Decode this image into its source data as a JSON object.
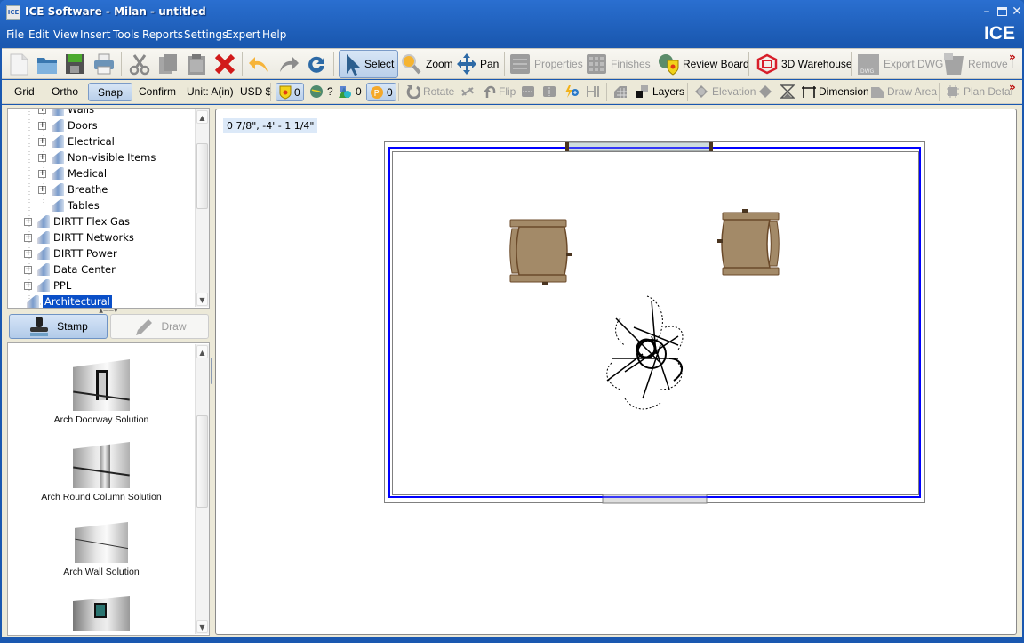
{
  "window": {
    "title": "ICE Software - Milan - untitled",
    "app_icon_text": "ICE",
    "brand": "ICE",
    "controls": [
      "minimize",
      "maximize",
      "close"
    ]
  },
  "menu": [
    "File",
    "Edit",
    "View",
    "Insert",
    "Tools",
    "Reports",
    "Settings",
    "Expert",
    "Help"
  ],
  "toolbar_main": {
    "file_buttons": [
      "new-file",
      "open-folder",
      "save",
      "print"
    ],
    "edit_buttons": [
      "cut",
      "copy",
      "paste",
      "delete"
    ],
    "history_buttons": [
      "undo",
      "redo",
      "refresh"
    ],
    "select": "Select",
    "zoom": "Zoom",
    "pan": "Pan",
    "properties": "Properties",
    "finishes": "Finishes",
    "review_board": "Review Board",
    "warehouse": "3D Warehouse",
    "export_dwg": "Export DWG",
    "remove": "Remove I",
    "more": "»"
  },
  "toolbar_secondary": {
    "grid": "Grid",
    "ortho": "Ortho",
    "snap": "Snap",
    "confirm": "Confirm",
    "unit": "Unit: A(in)",
    "currency": "USD $",
    "badges": [
      {
        "icon": "fire-shield-icon",
        "value": "0"
      },
      {
        "icon": "fyi-globe-icon",
        "value": "?"
      },
      {
        "icon": "shapes-icon",
        "value": "0"
      },
      {
        "icon": "p-coin-icon",
        "value": "0"
      }
    ],
    "rotate": "Rotate",
    "flip": "Flip",
    "layers": "Layers",
    "elevation": "Elevation",
    "dimension": "Dimension",
    "draw_area": "Draw Area",
    "plan_detail": "Plan Detai",
    "more": "»"
  },
  "tree": {
    "items": [
      {
        "label": "Walls",
        "level": 2,
        "expandable": true
      },
      {
        "label": "Doors",
        "level": 2,
        "expandable": true
      },
      {
        "label": "Electrical",
        "level": 2,
        "expandable": true
      },
      {
        "label": "Non-visible Items",
        "level": 2,
        "expandable": true
      },
      {
        "label": "Medical",
        "level": 2,
        "expandable": true
      },
      {
        "label": "Breathe",
        "level": 2,
        "expandable": true
      },
      {
        "label": "Tables",
        "level": 2,
        "expandable": false
      },
      {
        "label": "DIRTT Flex Gas",
        "level": 1,
        "expandable": true
      },
      {
        "label": "DIRTT Networks",
        "level": 1,
        "expandable": true
      },
      {
        "label": "DIRTT Power",
        "level": 1,
        "expandable": true
      },
      {
        "label": "Data Center",
        "level": 1,
        "expandable": true
      },
      {
        "label": "PPL",
        "level": 1,
        "expandable": true
      },
      {
        "label": "Architectural",
        "level": 0,
        "expandable": false,
        "selected": true
      }
    ]
  },
  "modes": {
    "stamp": "Stamp",
    "draw": "Draw",
    "active": "stamp"
  },
  "catalog": {
    "items": [
      {
        "label": "Arch Doorway Solution",
        "thumb": "doorway"
      },
      {
        "label": "Arch Round Column Solution",
        "thumb": "column"
      },
      {
        "label": "Arch Wall Solution",
        "thumb": "wall"
      },
      {
        "label": "",
        "thumb": "window"
      }
    ]
  },
  "canvas": {
    "coordinate_readout": "0 7/8\", -4' - 1 1/4\"",
    "objects": [
      "room-outline",
      "top-window",
      "bottom-door-opening",
      "chair-left",
      "chair-right",
      "plant"
    ]
  },
  "colors": {
    "title_bar": "#1a58b0",
    "wall_line": "#0000ff",
    "chair_fill": "#a38a68",
    "chair_stroke": "#6b4a2a",
    "selection": "#0a4fc8"
  }
}
